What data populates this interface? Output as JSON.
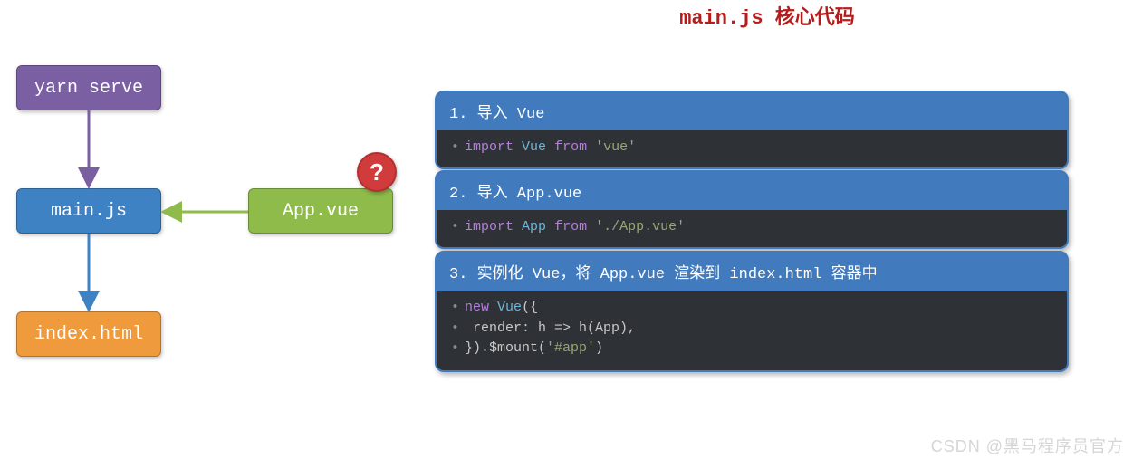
{
  "title": "main.js 核心代码",
  "nodes": {
    "yarn": "yarn serve",
    "main": "main.js",
    "app": "App.vue",
    "index": "index.html"
  },
  "badge": "?",
  "boxes": [
    {
      "header": "1. 导入 Vue",
      "lines": [
        [
          {
            "t": "kw-import",
            "v": "import"
          },
          {
            "t": "op",
            "v": " "
          },
          {
            "t": "cls",
            "v": "Vue"
          },
          {
            "t": "op",
            "v": " "
          },
          {
            "t": "from",
            "v": "from"
          },
          {
            "t": "op",
            "v": " "
          },
          {
            "t": "str",
            "v": "'vue'"
          }
        ]
      ]
    },
    {
      "header": "2. 导入 App.vue",
      "lines": [
        [
          {
            "t": "kw-import",
            "v": "import"
          },
          {
            "t": "op",
            "v": " "
          },
          {
            "t": "cls",
            "v": "App"
          },
          {
            "t": "op",
            "v": " "
          },
          {
            "t": "from",
            "v": "from"
          },
          {
            "t": "op",
            "v": " "
          },
          {
            "t": "str",
            "v": "'./App.vue'"
          }
        ]
      ]
    },
    {
      "header": "3. 实例化 Vue，将 App.vue 渲染到 index.html 容器中",
      "lines": [
        [
          {
            "t": "kw-new",
            "v": "new"
          },
          {
            "t": "op",
            "v": " "
          },
          {
            "t": "cls",
            "v": "Vue"
          },
          {
            "t": "plain",
            "v": "({"
          }
        ],
        [
          {
            "t": "plain",
            "v": "  render: h => h(App),"
          }
        ],
        [
          {
            "t": "plain",
            "v": "}).$mount("
          },
          {
            "t": "str",
            "v": "'#app'"
          },
          {
            "t": "plain",
            "v": ")"
          }
        ]
      ]
    }
  ],
  "watermark": "CSDN @黑马程序员官方"
}
